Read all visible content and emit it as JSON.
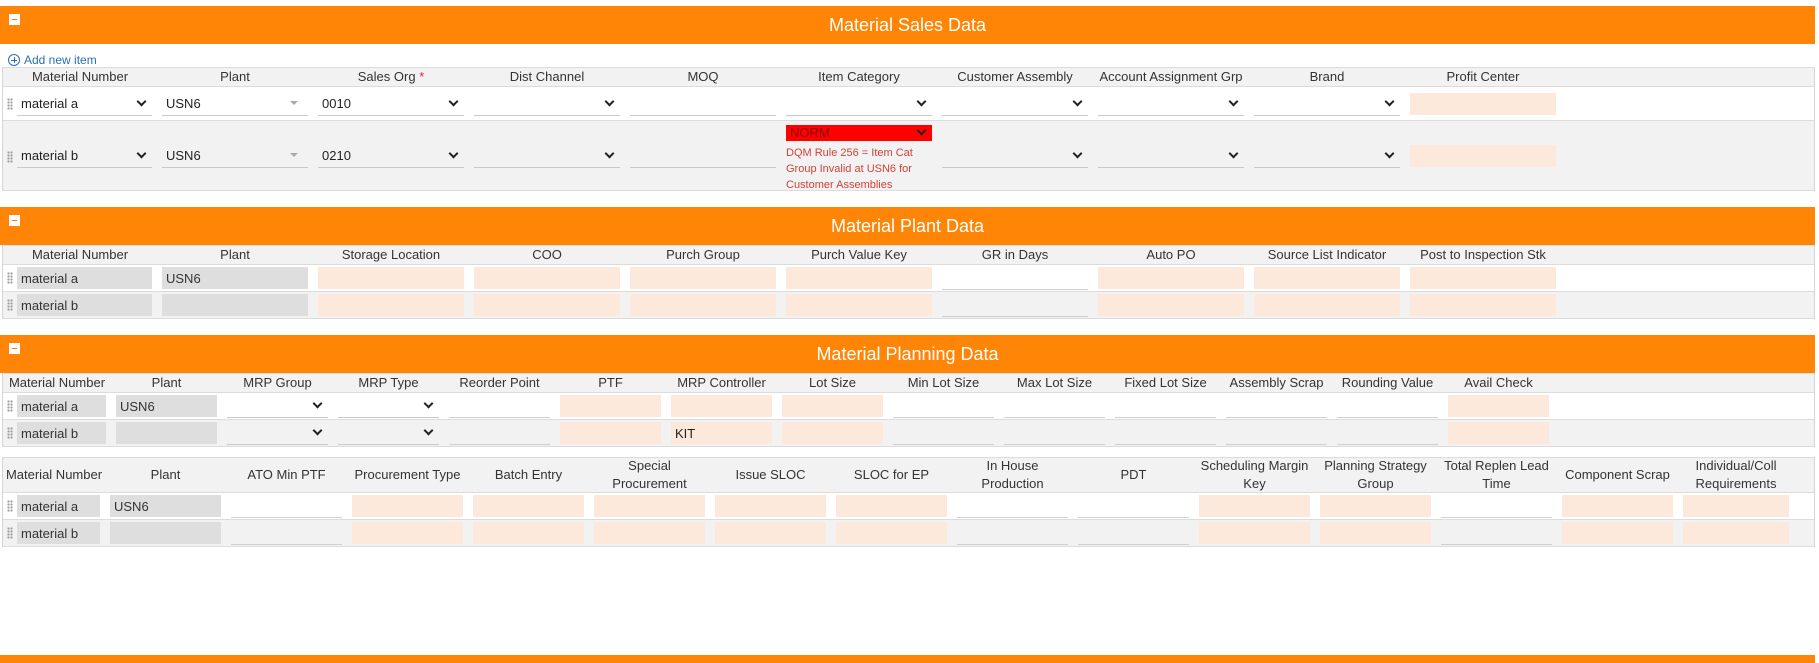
{
  "sales": {
    "title": "Material Sales Data",
    "add_label": "Add new item",
    "headers": [
      "Material Number",
      "Plant",
      "Sales Org",
      "Dist Channel",
      "MOQ",
      "Item Category",
      "Customer Assembly",
      "Account Assignment Grp",
      "Brand",
      "Profit Center"
    ],
    "required_mark": "*",
    "rows": [
      {
        "material": "material a",
        "plant": "USN6",
        "sales_org": "0010",
        "item_category": ""
      },
      {
        "material": "material b",
        "plant": "USN6",
        "sales_org": "0210",
        "item_category": "NORM",
        "error": "DQM Rule 256 = Item Cat Group Invalid at USN6 for Customer Assemblies"
      }
    ]
  },
  "plant": {
    "title": "Material Plant Data",
    "headers": [
      "Material Number",
      "Plant",
      "Storage Location",
      "COO",
      "Purch Group",
      "Purch Value Key",
      "GR in Days",
      "Auto PO",
      "Source List Indicator",
      "Post to Inspection Stk"
    ],
    "rows": [
      {
        "material": "material a",
        "plant": "USN6"
      },
      {
        "material": "material b",
        "plant": ""
      }
    ]
  },
  "planning": {
    "title": "Material Planning Data",
    "headers": [
      "Material Number",
      "Plant",
      "MRP Group",
      "MRP Type",
      "Reorder Point",
      "PTF",
      "MRP Controller",
      "Lot Size",
      "Min Lot Size",
      "Max Lot Size",
      "Fixed Lot Size",
      "Assembly Scrap",
      "Rounding Value",
      "Avail Check"
    ],
    "rows": [
      {
        "material": "material a",
        "plant": "USN6",
        "mrp_controller": ""
      },
      {
        "material": "material b",
        "plant": "",
        "mrp_controller": "KIT"
      }
    ],
    "headers2": [
      "Material Number",
      "Plant",
      "ATO Min PTF",
      "Procurement Type",
      "Batch Entry",
      "Special Procurement",
      "Issue SLOC",
      "SLOC for EP",
      "In House Production",
      "PDT",
      "Scheduling Margin Key",
      "Planning Strategy Group",
      "Total Replen Lead Time",
      "Component Scrap",
      "Individual/Coll Requirements"
    ],
    "rows2": [
      {
        "material": "material a",
        "plant": "USN6"
      },
      {
        "material": "material b",
        "plant": ""
      }
    ]
  },
  "colors": {
    "accent": "#ff8506",
    "error": "#ff0000",
    "peach": "#fde9dc"
  }
}
